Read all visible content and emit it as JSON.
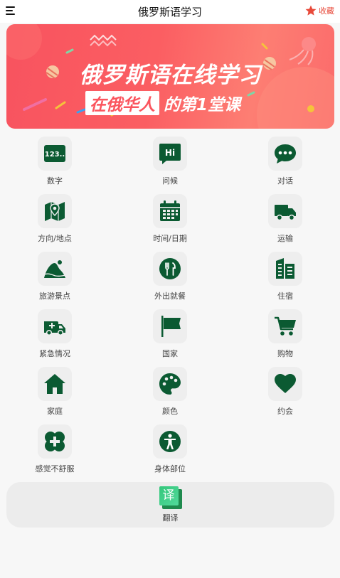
{
  "header": {
    "title": "俄罗斯语学习",
    "favorite_label": "收藏"
  },
  "banner": {
    "title": "俄罗斯语在线学习",
    "subtitle_boxed": "在俄华人",
    "subtitle_rest": "的第1堂课"
  },
  "categories": [
    {
      "label": "数字",
      "icon": "number-123-icon"
    },
    {
      "label": "问候",
      "icon": "hi-chat-icon"
    },
    {
      "label": "对话",
      "icon": "chat-bubble-icon"
    },
    {
      "label": "方向/地点",
      "icon": "map-pin-icon"
    },
    {
      "label": "时间/日期",
      "icon": "calendar-icon"
    },
    {
      "label": "运输",
      "icon": "truck-icon"
    },
    {
      "label": "旅游景点",
      "icon": "mountain-icon"
    },
    {
      "label": "外出就餐",
      "icon": "fork-knife-icon"
    },
    {
      "label": "住宿",
      "icon": "buildings-icon"
    },
    {
      "label": "紧急情况",
      "icon": "ambulance-icon"
    },
    {
      "label": "国家",
      "icon": "flag-icon"
    },
    {
      "label": "购物",
      "icon": "shopping-cart-icon"
    },
    {
      "label": "家庭",
      "icon": "house-icon"
    },
    {
      "label": "颜色",
      "icon": "palette-icon"
    },
    {
      "label": "约会",
      "icon": "heart-icon"
    },
    {
      "label": "感觉不舒服",
      "icon": "medical-cross-icon"
    },
    {
      "label": "身体部位",
      "icon": "person-body-icon"
    }
  ],
  "translate": {
    "icon_char": "译",
    "label": "翻译"
  },
  "colors": {
    "accent_green": "#0b5a32",
    "favorite_red": "#e84a3a",
    "banner_red": "#f8535f"
  }
}
